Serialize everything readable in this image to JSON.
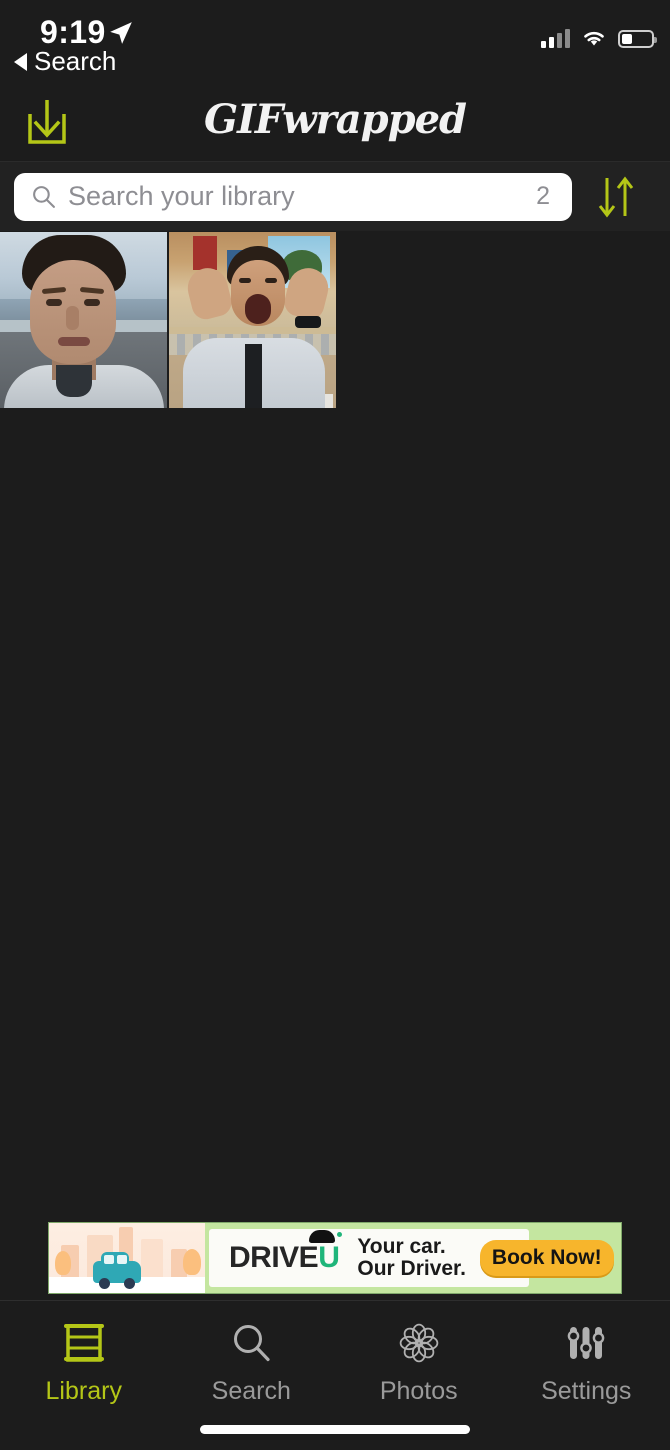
{
  "status_bar": {
    "time": "9:19",
    "location_icon": "location-arrow-icon",
    "signal_icon": "cellular-signal-icon",
    "signal_bars_filled": 2,
    "signal_bars_total": 4,
    "wifi_icon": "wifi-icon",
    "battery_icon": "battery-icon",
    "battery_level_pct": 33
  },
  "back": {
    "caret_icon": "back-caret-icon",
    "label": "Search"
  },
  "nav": {
    "download_icon": "download-icon",
    "title": "GIFwrapped",
    "accent_color": "#b4c617"
  },
  "search": {
    "icon": "magnifier-icon",
    "placeholder": "Search your library",
    "value": "",
    "count": "2",
    "sort_icon": "sort-arrows-icon"
  },
  "library": {
    "items": [
      {
        "name": "gif-thumbnail-1",
        "alt": "Man in grey flight suit looking at desert lake"
      },
      {
        "name": "gif-thumbnail-2",
        "alt": "Man in white shirt and tie shouting with hands raised in kitchen"
      }
    ]
  },
  "ad": {
    "brand_text": "DRIVE",
    "brand_accent_letter": "U",
    "line1": "Your car.",
    "line2": "Our Driver.",
    "cta": "Book Now!",
    "bg_color": "#c4e6a0",
    "cta_color": "#f7b52c"
  },
  "tabs": [
    {
      "label": "Library",
      "icon": "bookshelf-icon",
      "active": true
    },
    {
      "label": "Search",
      "icon": "magnifier-icon",
      "active": false
    },
    {
      "label": "Photos",
      "icon": "flower-rosette-icon",
      "active": false
    },
    {
      "label": "Settings",
      "icon": "sliders-icon",
      "active": false
    }
  ]
}
